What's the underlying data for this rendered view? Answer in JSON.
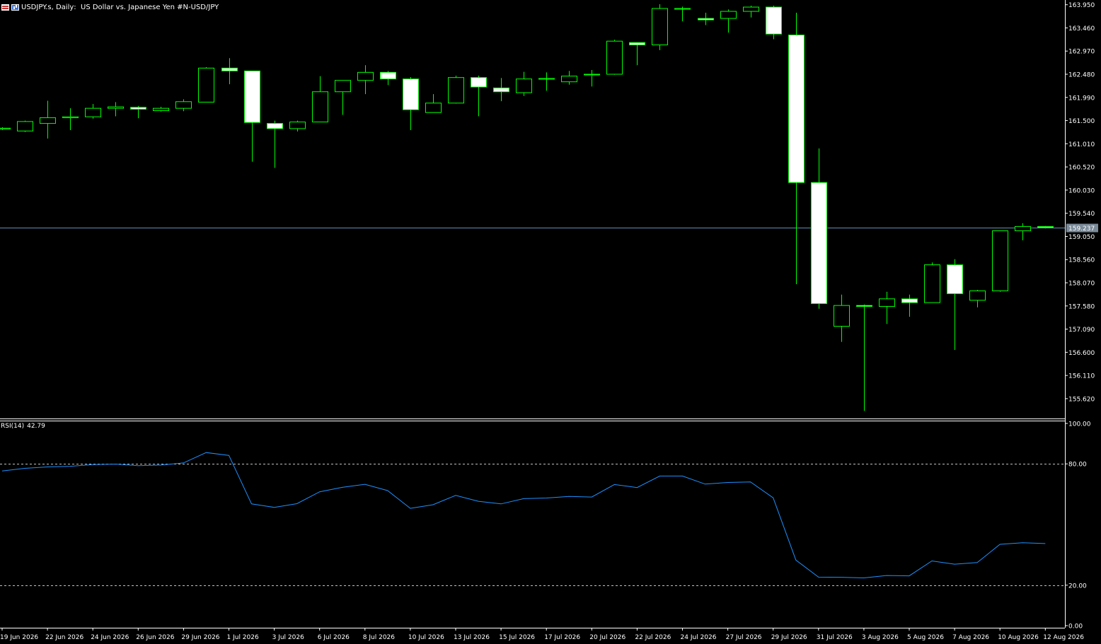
{
  "header": {
    "symbol": "USDJPY.s",
    "timeframe": "Daily",
    "description": "US Dollar vs. Japanese Yen #N-USD/JPY",
    "menu_icon": "chart-menu-icon",
    "type_icon": "bar-chart-icon"
  },
  "colors": {
    "background": "#000000",
    "candle_outline": "#00ff00",
    "bull_fill": "#000000",
    "bear_fill": "#ffffff",
    "rsi_line": "#1e90ff",
    "price_line": "#5f8fb0",
    "axis_text": "#ffffff"
  },
  "price_axis": {
    "ticks": [
      "163.950",
      "163.460",
      "162.970",
      "162.480",
      "161.990",
      "161.500",
      "161.010",
      "160.520",
      "160.030",
      "159.540",
      "159.050",
      "158.560",
      "158.070",
      "157.580",
      "157.090",
      "156.600",
      "156.110",
      "155.620"
    ],
    "current_price": "159.237"
  },
  "rsi": {
    "label": "RSI(14)",
    "value": "42.79",
    "ticks": [
      "100.00",
      "80.00",
      "20.00",
      "0.00"
    ],
    "levels": [
      80,
      20
    ]
  },
  "date_labels": [
    {
      "i": 0,
      "t": "19 Jun 2026"
    },
    {
      "i": 2,
      "t": "22 Jun 2026"
    },
    {
      "i": 4,
      "t": "24 Jun 2026"
    },
    {
      "i": 6,
      "t": "26 Jun 2026"
    },
    {
      "i": 8,
      "t": "29 Jun 2026"
    },
    {
      "i": 10,
      "t": "1 Jul 2026"
    },
    {
      "i": 12,
      "t": "3 Jul 2026"
    },
    {
      "i": 14,
      "t": "6 Jul 2026"
    },
    {
      "i": 16,
      "t": "8 Jul 2026"
    },
    {
      "i": 18,
      "t": "10 Jul 2026"
    },
    {
      "i": 20,
      "t": "13 Jul 2026"
    },
    {
      "i": 22,
      "t": "15 Jul 2026"
    },
    {
      "i": 24,
      "t": "17 Jul 2026"
    },
    {
      "i": 26,
      "t": "20 Jul 2026"
    },
    {
      "i": 28,
      "t": "22 Jul 2026"
    },
    {
      "i": 30,
      "t": "24 Jul 2026"
    },
    {
      "i": 32,
      "t": "27 Jul 2026"
    },
    {
      "i": 34,
      "t": "29 Jul 2026"
    },
    {
      "i": 36,
      "t": "31 Jul 2026"
    },
    {
      "i": 38,
      "t": "3 Aug 2026"
    },
    {
      "i": 40,
      "t": "5 Aug 2026"
    },
    {
      "i": 42,
      "t": "7 Aug 2026"
    },
    {
      "i": 44,
      "t": "10 Aug 2026"
    },
    {
      "i": 46,
      "t": "12 Aug 2026"
    }
  ],
  "chart_data": {
    "type": "candlestick",
    "ylim": [
      155.2,
      164.05
    ],
    "rsi_ylim": [
      0,
      100
    ],
    "candles": [
      {
        "o": 161.32,
        "h": 161.36,
        "l": 161.3,
        "c": 161.34
      },
      {
        "o": 161.28,
        "h": 161.5,
        "l": 161.26,
        "c": 161.48
      },
      {
        "o": 161.44,
        "h": 161.92,
        "l": 161.12,
        "c": 161.56
      },
      {
        "o": 161.56,
        "h": 161.76,
        "l": 161.3,
        "c": 161.58
      },
      {
        "o": 161.58,
        "h": 161.85,
        "l": 161.54,
        "c": 161.76
      },
      {
        "o": 161.76,
        "h": 161.89,
        "l": 161.59,
        "c": 161.79
      },
      {
        "o": 161.78,
        "h": 161.81,
        "l": 161.55,
        "c": 161.74
      },
      {
        "o": 161.71,
        "h": 161.79,
        "l": 161.69,
        "c": 161.76
      },
      {
        "o": 161.76,
        "h": 161.95,
        "l": 161.7,
        "c": 161.9
      },
      {
        "o": 161.89,
        "h": 162.63,
        "l": 161.89,
        "c": 162.61
      },
      {
        "o": 162.61,
        "h": 162.82,
        "l": 162.27,
        "c": 162.55
      },
      {
        "o": 162.55,
        "h": 162.55,
        "l": 160.63,
        "c": 161.46
      },
      {
        "o": 161.44,
        "h": 161.5,
        "l": 160.5,
        "c": 161.33
      },
      {
        "o": 161.33,
        "h": 161.5,
        "l": 161.27,
        "c": 161.47
      },
      {
        "o": 161.47,
        "h": 162.44,
        "l": 161.47,
        "c": 162.11
      },
      {
        "o": 162.11,
        "h": 162.35,
        "l": 161.62,
        "c": 162.35
      },
      {
        "o": 162.35,
        "h": 162.67,
        "l": 162.06,
        "c": 162.52
      },
      {
        "o": 162.52,
        "h": 162.55,
        "l": 162.25,
        "c": 162.38
      },
      {
        "o": 162.38,
        "h": 162.42,
        "l": 161.3,
        "c": 161.73
      },
      {
        "o": 161.67,
        "h": 162.06,
        "l": 161.67,
        "c": 161.87
      },
      {
        "o": 161.87,
        "h": 162.45,
        "l": 161.86,
        "c": 162.41
      },
      {
        "o": 162.41,
        "h": 162.45,
        "l": 161.59,
        "c": 162.21
      },
      {
        "o": 162.19,
        "h": 162.4,
        "l": 161.91,
        "c": 162.11
      },
      {
        "o": 162.09,
        "h": 162.53,
        "l": 162.02,
        "c": 162.38
      },
      {
        "o": 162.38,
        "h": 162.52,
        "l": 162.13,
        "c": 162.39
      },
      {
        "o": 162.32,
        "h": 162.55,
        "l": 162.26,
        "c": 162.44
      },
      {
        "o": 162.47,
        "h": 162.57,
        "l": 162.22,
        "c": 162.48
      },
      {
        "o": 162.48,
        "h": 163.21,
        "l": 162.47,
        "c": 163.18
      },
      {
        "o": 163.15,
        "h": 163.15,
        "l": 162.67,
        "c": 163.1
      },
      {
        "o": 163.1,
        "h": 163.96,
        "l": 162.99,
        "c": 163.87
      },
      {
        "o": 163.87,
        "h": 163.91,
        "l": 163.6,
        "c": 163.87
      },
      {
        "o": 163.66,
        "h": 163.78,
        "l": 163.52,
        "c": 163.63
      },
      {
        "o": 163.66,
        "h": 163.85,
        "l": 163.36,
        "c": 163.81
      },
      {
        "o": 163.81,
        "h": 163.93,
        "l": 163.68,
        "c": 163.9
      },
      {
        "o": 163.9,
        "h": 163.93,
        "l": 163.22,
        "c": 163.33
      },
      {
        "o": 163.31,
        "h": 163.78,
        "l": 158.04,
        "c": 160.19
      },
      {
        "o": 160.19,
        "h": 160.91,
        "l": 157.52,
        "c": 157.63
      },
      {
        "o": 157.15,
        "h": 157.82,
        "l": 156.82,
        "c": 157.59
      },
      {
        "o": 157.59,
        "h": 157.61,
        "l": 155.36,
        "c": 157.57
      },
      {
        "o": 157.57,
        "h": 157.88,
        "l": 157.2,
        "c": 157.73
      },
      {
        "o": 157.73,
        "h": 157.82,
        "l": 157.35,
        "c": 157.65
      },
      {
        "o": 157.65,
        "h": 158.5,
        "l": 157.65,
        "c": 158.45
      },
      {
        "o": 158.45,
        "h": 158.57,
        "l": 156.65,
        "c": 157.84
      },
      {
        "o": 157.7,
        "h": 157.92,
        "l": 157.55,
        "c": 157.9
      },
      {
        "o": 157.9,
        "h": 159.17,
        "l": 157.88,
        "c": 159.17
      },
      {
        "o": 159.17,
        "h": 159.33,
        "l": 158.97,
        "c": 159.26
      },
      {
        "o": 159.26,
        "h": 159.27,
        "l": 159.22,
        "c": 159.24
      }
    ],
    "rsi_values": [
      76.5,
      77.8,
      78.5,
      78.8,
      79.6,
      79.9,
      79.1,
      79.4,
      80.5,
      85.6,
      84.2,
      60.2,
      58.5,
      60.3,
      66.2,
      68.4,
      69.9,
      66.8,
      58.0,
      59.8,
      64.4,
      61.5,
      60.2,
      62.8,
      63.1,
      63.9,
      63.6,
      69.8,
      68.3,
      74.0,
      74.0,
      70.0,
      70.8,
      71.1,
      63.2,
      32.4,
      24.0,
      23.9,
      23.6,
      24.8,
      24.6,
      32.0,
      30.4,
      31.2,
      40.2,
      41.0,
      40.6
    ]
  }
}
